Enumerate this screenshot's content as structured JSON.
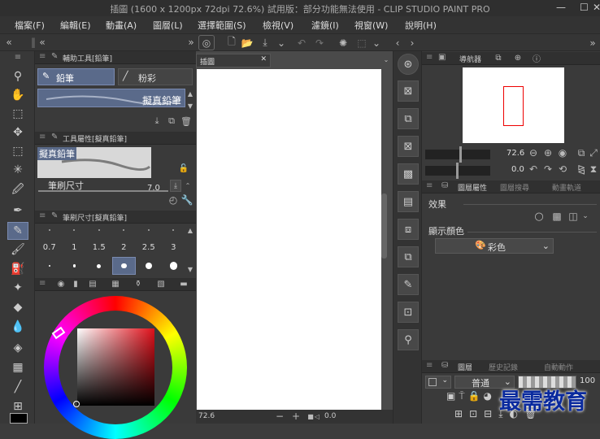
{
  "window": {
    "title": "插圖 (1600 x 1200px 72dpi 72.6%) 試用版：部分功能無法使用 - CLIP STUDIO PAINT PRO",
    "minimize": "—",
    "maximize": "☐",
    "close": "✕"
  },
  "menu": [
    "檔案(F)",
    "編輯(E)",
    "動畫(A)",
    "圖層(L)",
    "選擇範圍(S)",
    "檢視(V)",
    "濾鏡(I)",
    "視窗(W)",
    "說明(H)"
  ],
  "sub_tool_panel": {
    "title": "輔助工具[鉛筆]",
    "tabs": [
      "鉛筆",
      "粉彩"
    ],
    "brush_name": "擬真鉛筆"
  },
  "tool_property_panel": {
    "title": "工具屬性[擬真鉛筆]",
    "brush_name": "擬真鉛筆",
    "size_label": "筆刷尺寸",
    "size_value": "7.0"
  },
  "brush_size_panel": {
    "title": "筆刷尺寸[擬真鉛筆]",
    "sizes": [
      "0.7",
      "1",
      "1.5",
      "2",
      "2.5",
      "3"
    ],
    "selected_index": 3
  },
  "color_panel": {
    "hue_color": "#e0101a"
  },
  "canvas": {
    "tab": "插圖",
    "tab_close": "✕",
    "zoom": "72.6",
    "rotation": "0.0"
  },
  "navigator": {
    "title": "導航器",
    "zoom": "72.6",
    "rotation": "0.0"
  },
  "layer_property": {
    "title": "圖層屬性",
    "tab2": "圖層搜尋",
    "tab3": "動畫軌道",
    "effect_label": "效果",
    "display_color_label": "顯示顏色",
    "display_color_value": "彩色"
  },
  "layer_panel": {
    "title": "圖層",
    "tab2": "歷史記錄",
    "tab3": "自動動作",
    "blend_mode": "普通",
    "opacity": "100"
  },
  "watermark": "最需教育"
}
